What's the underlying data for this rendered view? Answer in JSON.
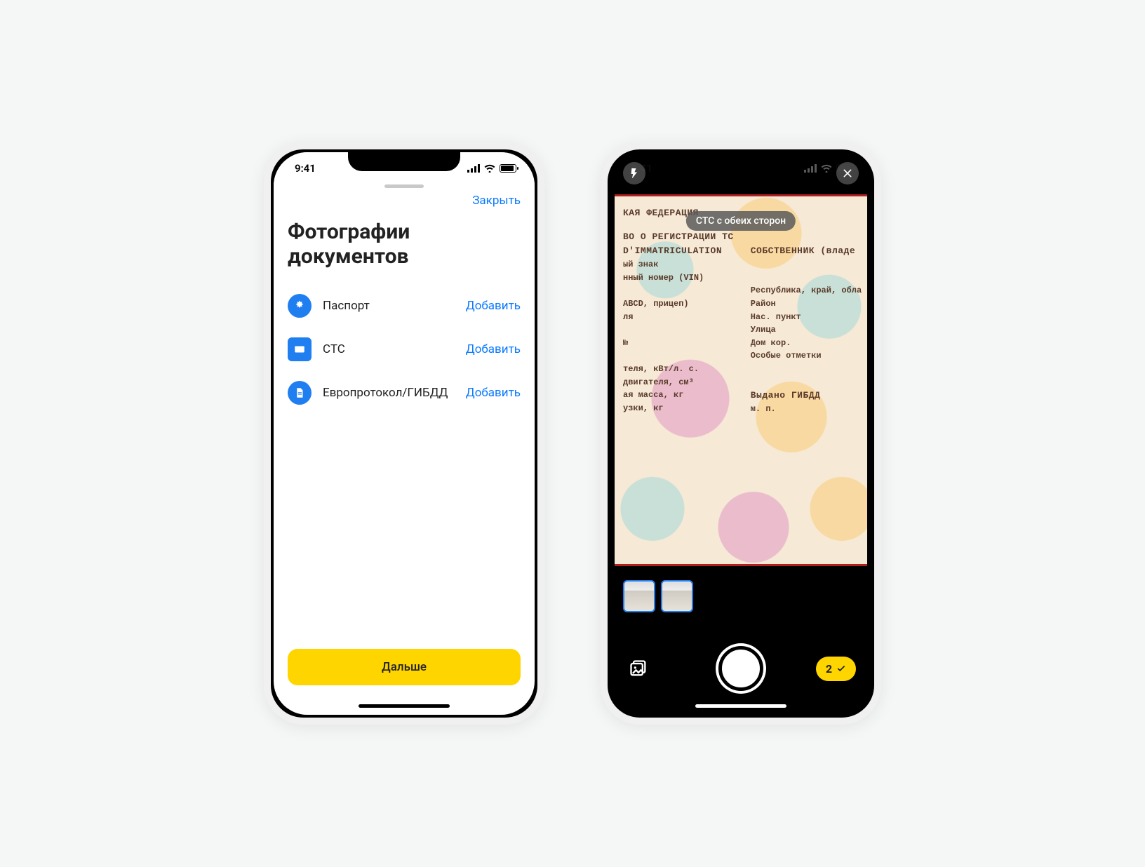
{
  "status": {
    "time": "9:41"
  },
  "screen1": {
    "close": "Закрыть",
    "title_line1": "Фотографии",
    "title_line2": "документов",
    "docs": [
      {
        "label": "Паспорт",
        "action": "Добавить"
      },
      {
        "label": "СТС",
        "action": "Добавить"
      },
      {
        "label": "Европротокол/ГИБДД",
        "action": "Добавить"
      }
    ],
    "next": "Дальше"
  },
  "screen2": {
    "caption": "СТС с обеих сторон",
    "done_count": "2",
    "doc_left": {
      "l1": "КАЯ ФЕДЕРАЦИЯ",
      "l2": "ВО О РЕГИСТРАЦИИ ТС",
      "l3": "D'IMMATRICULATION",
      "l4": "ый знак",
      "l5": "нный номер (VIN)",
      "l6": "ABCD, прицеп)",
      "l7": "ля",
      "l8": "№",
      "l9": "теля, кВт/л. с.",
      "l10": "двигателя, см³",
      "l11": "ая масса, кг",
      "l12": "узки, кг"
    },
    "doc_right": {
      "r1": "СОБСТВЕННИК (владе",
      "r2": "Республика, край, обла",
      "r3": "Район",
      "r4": "Нас. пункт",
      "r5": "Улица",
      "r6": "Дом         кор.",
      "r7": "Особые отметки",
      "r8": "Выдано ГИБДД",
      "r9": "м. п."
    }
  }
}
